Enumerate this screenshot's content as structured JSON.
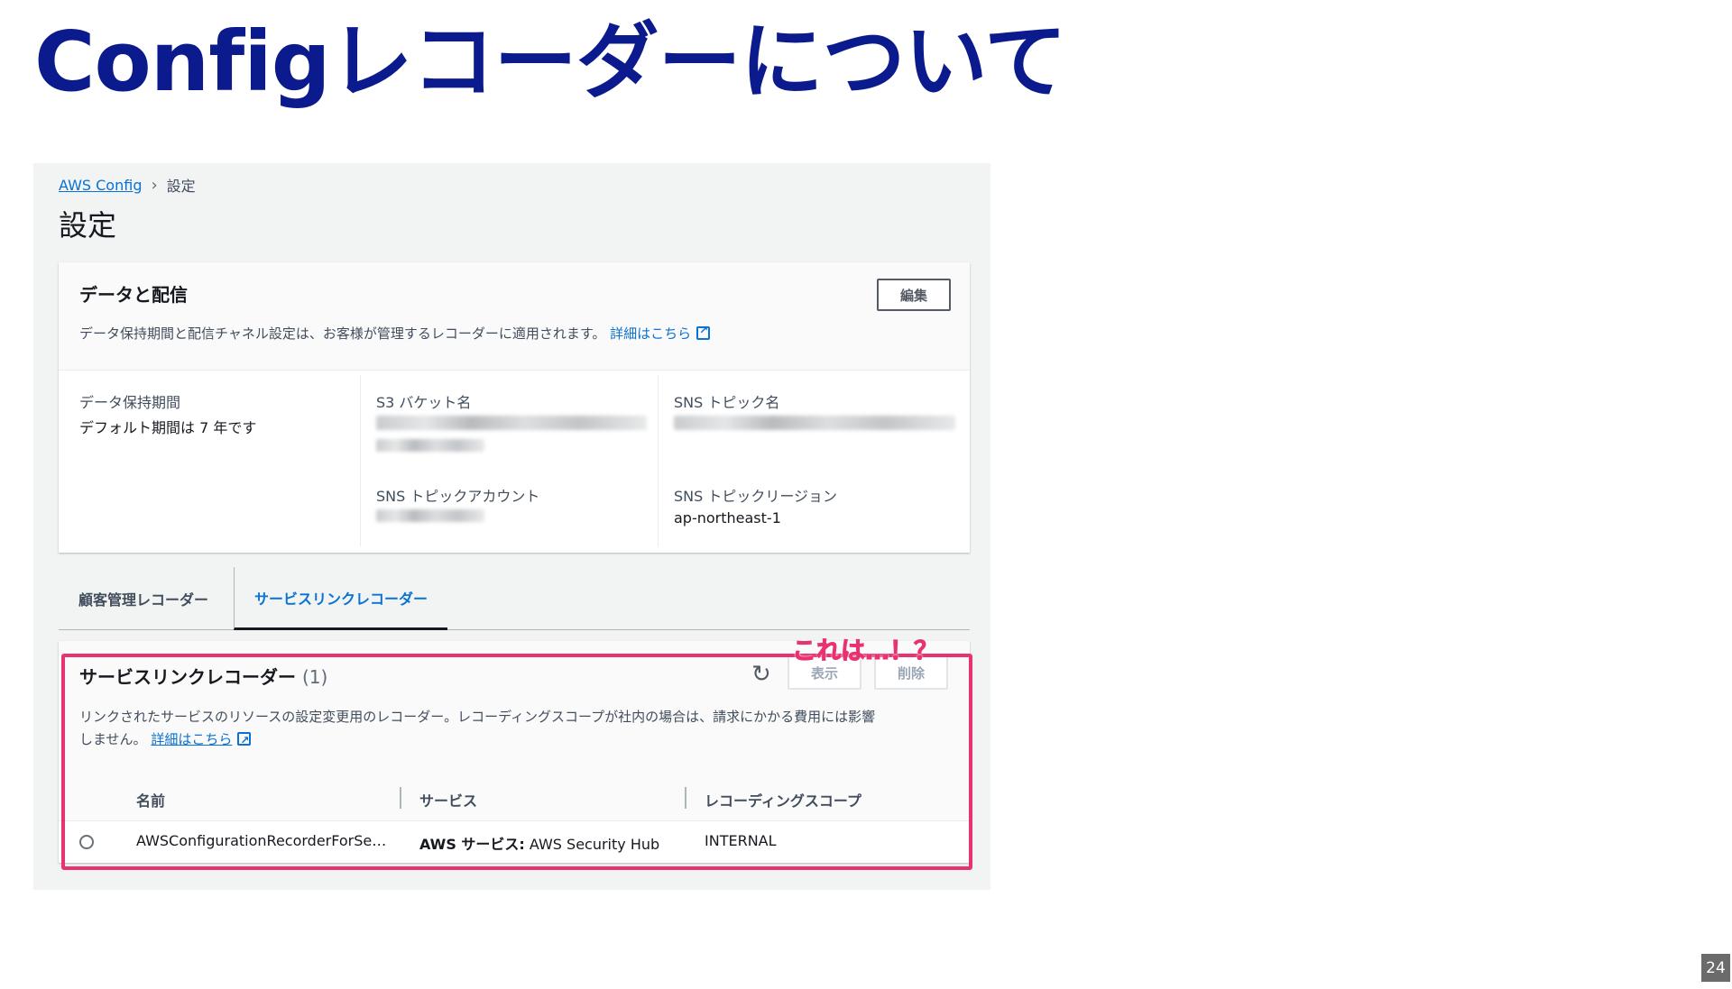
{
  "slide": {
    "title": "Configレコーダーについて",
    "page_number": "24",
    "annotation": "これは…！？"
  },
  "breadcrumb": {
    "root": "AWS Config",
    "current": "設定"
  },
  "page_title": "設定",
  "data_delivery": {
    "title": "データと配信",
    "edit_label": "編集",
    "description": "データ保持期間と配信チャネル設定は、お客様が管理するレコーダーに適用されます。",
    "learn_more": "詳細はこちら",
    "fields": {
      "retention_label": "データ保持期間",
      "retention_value": "デフォルト期間は 7 年です",
      "s3_label": "S3 バケット名",
      "sns_topic_label": "SNS トピック名",
      "sns_account_label": "SNS トピックアカウント",
      "sns_region_label": "SNS トピックリージョン",
      "sns_region_value": "ap-northeast-1"
    }
  },
  "tabs": [
    {
      "label": "顧客管理レコーダー",
      "selected": false
    },
    {
      "label": "サービスリンクレコーダー",
      "selected": true
    }
  ],
  "service_linked": {
    "title": "サービスリンクレコーダー",
    "count": "(1)",
    "view_label": "表示",
    "delete_label": "削除",
    "description_line1": "リンクされたサービスのリソースの設定変更用のレコーダー。レコーディングスコープが社内の場合は、請求にかかる費用には影響",
    "description_line2": "しません。",
    "learn_more": "詳細はこちら",
    "columns": [
      "名前",
      "サービス",
      "レコーディングスコープ"
    ],
    "rows": [
      {
        "name": "AWSConfigurationRecorderForSe…",
        "service_prefix": "AWS サービス:",
        "service_value": "AWS Security Hub",
        "scope": "INTERNAL"
      }
    ]
  },
  "colors": {
    "title": "#0b1a8c",
    "link": "#0972d3",
    "highlight": "#e8336e",
    "console_bg": "#f2f3f3"
  }
}
